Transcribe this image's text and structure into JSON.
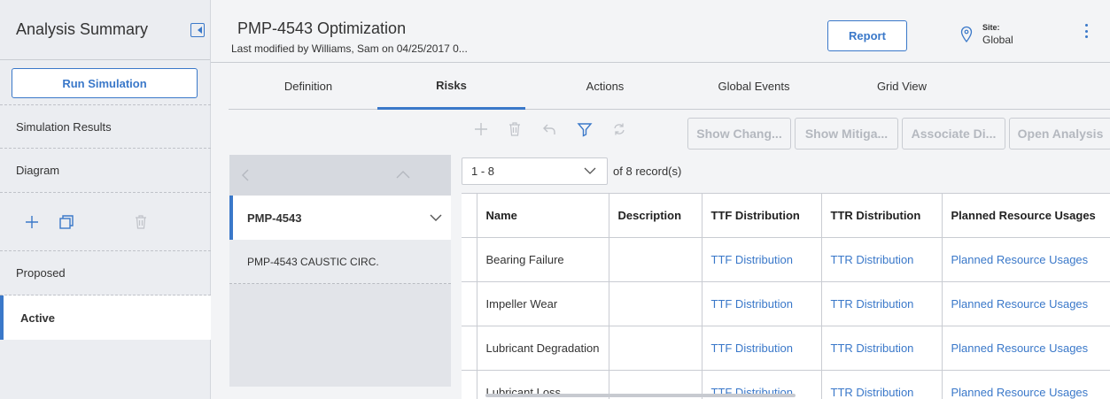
{
  "sidebar": {
    "title": "Analysis Summary",
    "run_simulation": "Run Simulation",
    "simulation_results": "Simulation Results",
    "diagram": "Diagram",
    "proposed": "Proposed",
    "active": "Active"
  },
  "header": {
    "title": "PMP-4543 Optimization",
    "subtitle": "Last modified by Williams, Sam on 04/25/2017 0...",
    "report_button": "Report",
    "site_label": "Site:",
    "site_value": "Global"
  },
  "tabs": [
    {
      "label": "Definition",
      "active": false
    },
    {
      "label": "Risks",
      "active": true
    },
    {
      "label": "Actions",
      "active": false
    },
    {
      "label": "Global Events",
      "active": false
    },
    {
      "label": "Grid View",
      "active": false
    }
  ],
  "toolbar": {
    "buttons": [
      "Show Chang...",
      "Show Mitiga...",
      "Associate Di...",
      "Open Analysis"
    ]
  },
  "tree": {
    "selected": "PMP-4543",
    "child": "PMP-4543 CAUSTIC CIRC."
  },
  "pager": {
    "range": "1 - 8",
    "of_label": "of",
    "total": "8",
    "records_label": "record(s)"
  },
  "grid": {
    "columns": [
      "Name",
      "Description",
      "TTF Distribution",
      "TTR Distribution",
      "Planned Resource Usages"
    ],
    "rows": [
      {
        "name": "Bearing Failure",
        "description": "",
        "ttf": "TTF Distribution",
        "ttr": "TTR Distribution",
        "pru": "Planned Resource Usages"
      },
      {
        "name": "Impeller Wear",
        "description": "",
        "ttf": "TTF Distribution",
        "ttr": "TTR Distribution",
        "pru": "Planned Resource Usages"
      },
      {
        "name": "Lubricant Degradation",
        "description": "",
        "ttf": "TTF Distribution",
        "ttr": "TTR Distribution",
        "pru": "Planned Resource Usages"
      },
      {
        "name": "Lubricant Loss",
        "description": "",
        "ttf": "TTF Distribution",
        "ttr": "TTR Distribution",
        "pru": "Planned Resource Usages"
      }
    ]
  },
  "colors": {
    "accent": "#3a78c9",
    "disabled_text": "#b4b8bf",
    "panel_bg": "#ebedf1"
  }
}
